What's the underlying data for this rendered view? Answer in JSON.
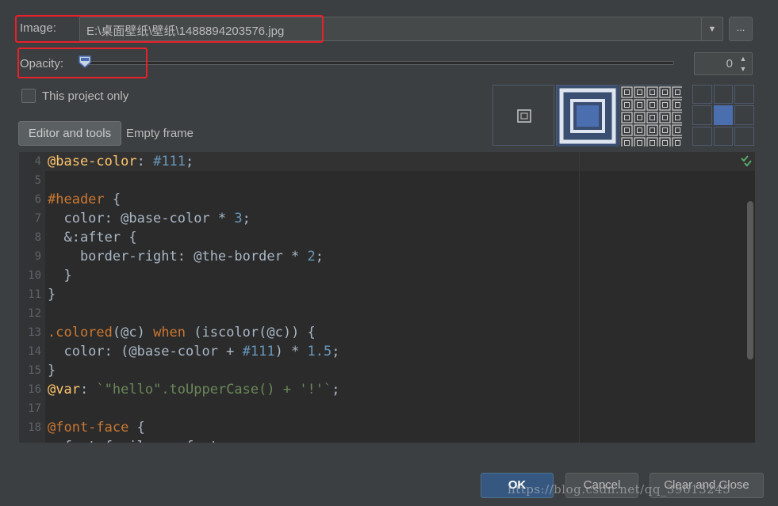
{
  "image": {
    "label": "Image:",
    "value": "E:\\桌面壁纸\\壁纸\\1488894203576.jpg",
    "dropdown_icon": "chevron-down-icon",
    "browse_label": "..."
  },
  "opacity": {
    "label": "Opacity:",
    "value": "0",
    "slider_level": 0
  },
  "project_only": {
    "label": "This project only",
    "checked": false
  },
  "fill_modes": [
    "center-icon",
    "stretch-icon",
    "tile-icon"
  ],
  "anchor": {
    "selected": "center"
  },
  "tabs": {
    "editor": "Editor and tools",
    "empty": "Empty frame"
  },
  "code_lines": [
    {
      "n": "4",
      "t": "@base-color: #111;"
    },
    {
      "n": "5",
      "t": ""
    },
    {
      "n": "6",
      "t": "#header {"
    },
    {
      "n": "7",
      "t": "  color: @base-color * 3;"
    },
    {
      "n": "8",
      "t": "  &:after {"
    },
    {
      "n": "9",
      "t": "    border-right: @the-border * 2;"
    },
    {
      "n": "10",
      "t": "  }"
    },
    {
      "n": "11",
      "t": "}"
    },
    {
      "n": "12",
      "t": ""
    },
    {
      "n": "13",
      "t": ".colored(@c) when (iscolor(@c)) {"
    },
    {
      "n": "14",
      "t": "  color: (@base-color + #111) * 1.5;"
    },
    {
      "n": "15",
      "t": "}"
    },
    {
      "n": "16",
      "t": "@var: `\"hello\".toUpperCase() + '!'`;"
    },
    {
      "n": "17",
      "t": ""
    },
    {
      "n": "18",
      "t": "@font-face {"
    },
    {
      "n": "",
      "t": "  font-family: myfont;"
    }
  ],
  "buttons": {
    "ok": "OK",
    "cancel": "Cancel",
    "clear_close": "Clear and Close"
  },
  "watermark": "https://blog.csdn.net/qq_39613245",
  "colors": {
    "highlight": "#e8202a",
    "accent": "#4b6eaf",
    "background": "#3c3f41",
    "editor_bg": "#2b2b2b"
  }
}
